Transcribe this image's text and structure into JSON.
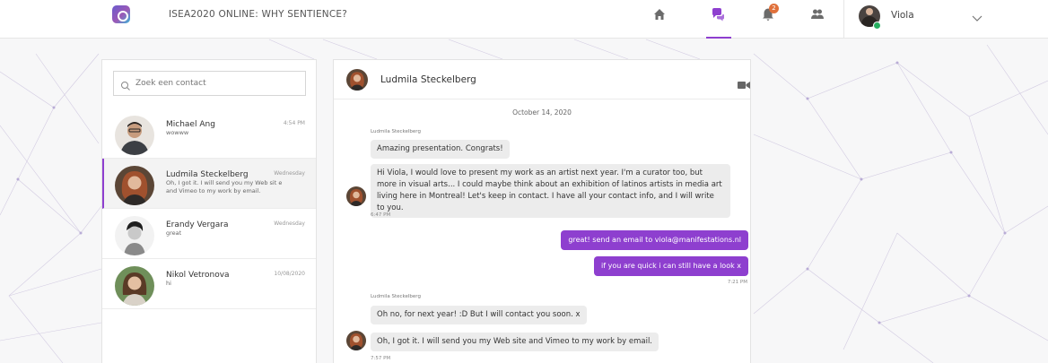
{
  "header": {
    "title": "ISEA2020 ONLINE: WHY SENTIENCE?",
    "notification_count": "2",
    "user_name": "Viola"
  },
  "contacts": {
    "search_placeholder": "Zoek een contact",
    "items": [
      {
        "name": "Michael Ang",
        "preview": "wowww",
        "time": "4:54 PM"
      },
      {
        "name": "Ludmila Steckelberg",
        "preview": "Oh, I got it. I will send you my Web sit e and Vimeo to my work by email.",
        "time": "Wednesday"
      },
      {
        "name": "Erandy Vergara",
        "preview": "great",
        "time": "Wednesday"
      },
      {
        "name": "Nikol Vetronova",
        "preview": "hi",
        "time": "10/08/2020"
      }
    ]
  },
  "chat": {
    "contact_name": "Ludmila Steckelberg",
    "date": "October 14, 2020",
    "messages": [
      {
        "sender": "Ludmila Steckelberg",
        "text": "Amazing presentation. Congrats!"
      },
      {
        "text": "Hi Viola, I would love to present my work as an artist next year. I'm a curator too, but more in visual arts... I could maybe think about an exhibition of latinos artists in media art living here in Montreal! Let's keep in contact. I have all your contact info, and I will write to you.",
        "time": "6:47 PM"
      },
      {
        "text": "great! send an email to viola@manifestations.nl"
      },
      {
        "text": "if you are quick i can still have a look x",
        "time": "7:21 PM"
      },
      {
        "sender": "Ludmila Steckelberg",
        "text": "Oh no, for next year! :D But I will contact you soon. x"
      },
      {
        "text": "Oh, I got it. I will send you my Web site and Vimeo to my work by email.",
        "time": "7:57 PM"
      }
    ]
  },
  "colors": {
    "accent": "#8e3fcf",
    "online": "#27ae60",
    "badge": "#e0703a"
  }
}
